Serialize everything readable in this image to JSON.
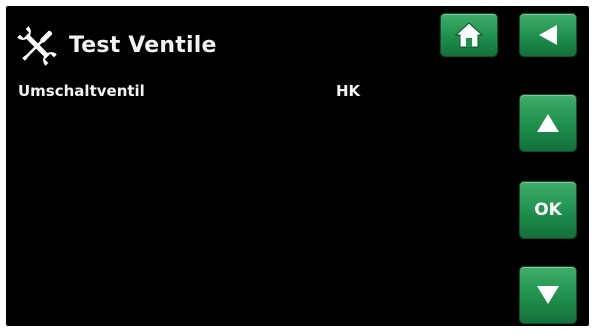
{
  "header": {
    "title": "Test Ventile",
    "icon": "wrench-screwdriver-icon"
  },
  "rows": [
    {
      "label": "Umschaltventil",
      "value": "HK"
    }
  ],
  "buttons": {
    "home_icon": "home-icon",
    "back_icon": "back-arrow-icon",
    "up_icon": "up-arrow-icon",
    "ok_label": "OK",
    "down_icon": "down-arrow-icon"
  },
  "colors": {
    "background": "#000000",
    "text": "#f2f2f2",
    "button_green": "#1e8f4c"
  }
}
